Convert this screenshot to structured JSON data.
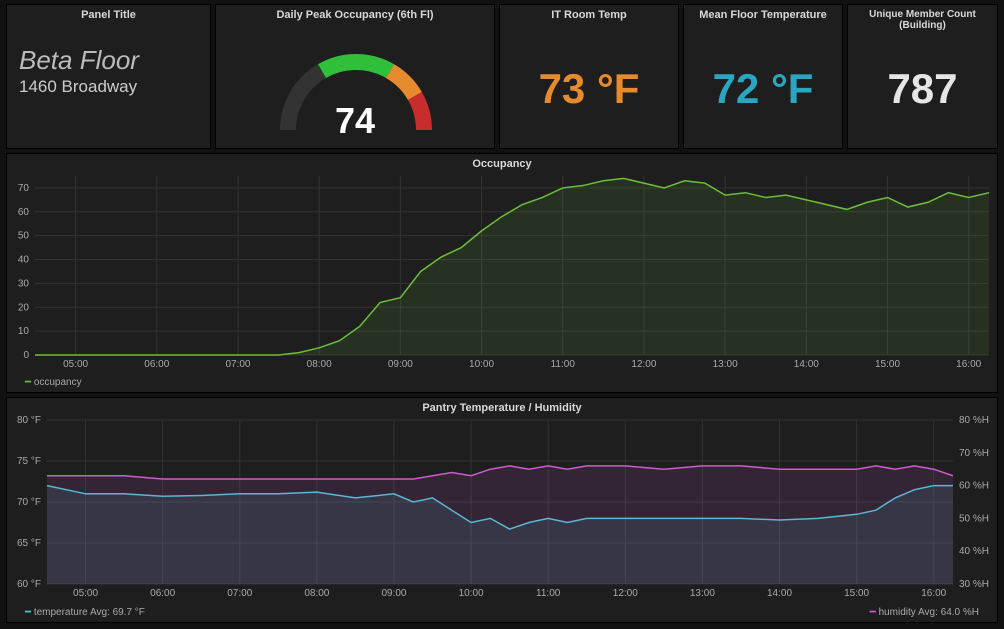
{
  "panels": {
    "title": {
      "header": "Panel Title",
      "line1": "Beta Floor",
      "line2": "1460 Broadway"
    },
    "gauge": {
      "header": "Daily Peak Occupancy (6th Fl)",
      "value": "74"
    },
    "it_temp": {
      "header": "IT Room Temp",
      "value": "73 °F",
      "color": "#e68a2e"
    },
    "mean_temp": {
      "header": "Mean Floor Temperature",
      "value": "72 °F",
      "color": "#2aa6c2"
    },
    "members": {
      "header": "Unique Member Count (Building)",
      "value": "787",
      "color": "#e6e6e6"
    }
  },
  "occupancy": {
    "header": "Occupancy",
    "legend": "occupancy",
    "color": "#6bbf3a"
  },
  "pantry": {
    "header": "Pantry Temperature / Humidity",
    "legend_temp": "temperature  Avg: 69.7 °F",
    "legend_hum": "humidity  Avg: 64.0 %H",
    "temp_color": "#4dc3d6",
    "hum_color": "#cf5bd0"
  },
  "chart_data": [
    {
      "type": "line",
      "title": "Occupancy",
      "xlabel": "",
      "ylabel": "",
      "ylim": [
        0,
        75
      ],
      "x_ticks": [
        "05:00",
        "06:00",
        "07:00",
        "08:00",
        "09:00",
        "10:00",
        "11:00",
        "12:00",
        "13:00",
        "14:00",
        "15:00",
        "16:00"
      ],
      "y_ticks": [
        0,
        10,
        20,
        30,
        40,
        50,
        60,
        70
      ],
      "series": [
        {
          "name": "occupancy",
          "color": "#6bbf3a",
          "x": [
            "04:30",
            "05:00",
            "05:30",
            "06:00",
            "06:30",
            "07:00",
            "07:15",
            "07:30",
            "07:45",
            "08:00",
            "08:15",
            "08:30",
            "08:45",
            "09:00",
            "09:15",
            "09:30",
            "09:45",
            "10:00",
            "10:15",
            "10:30",
            "10:45",
            "11:00",
            "11:15",
            "11:30",
            "11:45",
            "12:00",
            "12:15",
            "12:30",
            "12:45",
            "13:00",
            "13:15",
            "13:30",
            "13:45",
            "14:00",
            "14:15",
            "14:30",
            "14:45",
            "15:00",
            "15:15",
            "15:30",
            "15:45",
            "16:00",
            "16:15"
          ],
          "y": [
            0,
            0,
            0,
            0,
            0,
            0,
            0,
            0,
            1,
            3,
            6,
            12,
            22,
            24,
            35,
            41,
            45,
            52,
            58,
            63,
            66,
            70,
            71,
            73,
            74,
            72,
            70,
            73,
            72,
            67,
            68,
            66,
            67,
            65,
            63,
            61,
            64,
            66,
            62,
            64,
            68,
            66,
            68
          ]
        }
      ]
    },
    {
      "type": "line",
      "title": "Pantry Temperature / Humidity",
      "xlabel": "",
      "ylabel_left": "°F",
      "ylabel_right": "%H",
      "ylim_left": [
        60,
        80
      ],
      "ylim_right": [
        30,
        80
      ],
      "x_ticks": [
        "05:00",
        "06:00",
        "07:00",
        "08:00",
        "09:00",
        "10:00",
        "11:00",
        "12:00",
        "13:00",
        "14:00",
        "15:00",
        "16:00"
      ],
      "y_ticks_left": [
        "60 °F",
        "65 °F",
        "70 °F",
        "75 °F",
        "80 °F"
      ],
      "y_ticks_right": [
        "30 %H",
        "40 %H",
        "50 %H",
        "60 %H",
        "70 %H",
        "80 %H"
      ],
      "series": [
        {
          "name": "temperature",
          "axis": "left",
          "color": "#4dc3d6",
          "x": [
            "04:30",
            "05:00",
            "05:30",
            "06:00",
            "06:30",
            "07:00",
            "07:30",
            "08:00",
            "08:30",
            "09:00",
            "09:15",
            "09:30",
            "09:45",
            "10:00",
            "10:15",
            "10:30",
            "10:45",
            "11:00",
            "11:15",
            "11:30",
            "11:45",
            "12:00",
            "12:30",
            "13:00",
            "13:30",
            "14:00",
            "14:30",
            "15:00",
            "15:15",
            "15:30",
            "15:45",
            "16:00",
            "16:15"
          ],
          "y": [
            72.0,
            71.0,
            71.0,
            70.7,
            70.8,
            71.0,
            71.0,
            71.2,
            70.5,
            71.0,
            70.0,
            70.5,
            69.0,
            67.5,
            68.0,
            66.7,
            67.5,
            68.0,
            67.5,
            68.0,
            68.0,
            68.0,
            68.0,
            68.0,
            68.0,
            67.8,
            68.0,
            68.5,
            69.0,
            70.5,
            71.5,
            72.0,
            72.0
          ]
        },
        {
          "name": "humidity",
          "axis": "right",
          "color": "#cf5bd0",
          "x": [
            "04:30",
            "05:00",
            "05:30",
            "06:00",
            "06:30",
            "07:00",
            "07:30",
            "08:00",
            "08:30",
            "09:00",
            "09:15",
            "09:30",
            "09:45",
            "10:00",
            "10:15",
            "10:30",
            "10:45",
            "11:00",
            "11:15",
            "11:30",
            "11:45",
            "12:00",
            "12:30",
            "13:00",
            "13:30",
            "14:00",
            "14:30",
            "15:00",
            "15:15",
            "15:30",
            "15:45",
            "16:00",
            "16:15"
          ],
          "y": [
            63,
            63,
            63,
            62,
            62,
            62,
            62,
            62,
            62,
            62,
            62,
            63,
            64,
            63,
            65,
            66,
            65,
            66,
            65,
            66,
            66,
            66,
            65,
            66,
            66,
            65,
            65,
            65,
            66,
            65,
            66,
            65,
            63
          ]
        }
      ]
    }
  ]
}
